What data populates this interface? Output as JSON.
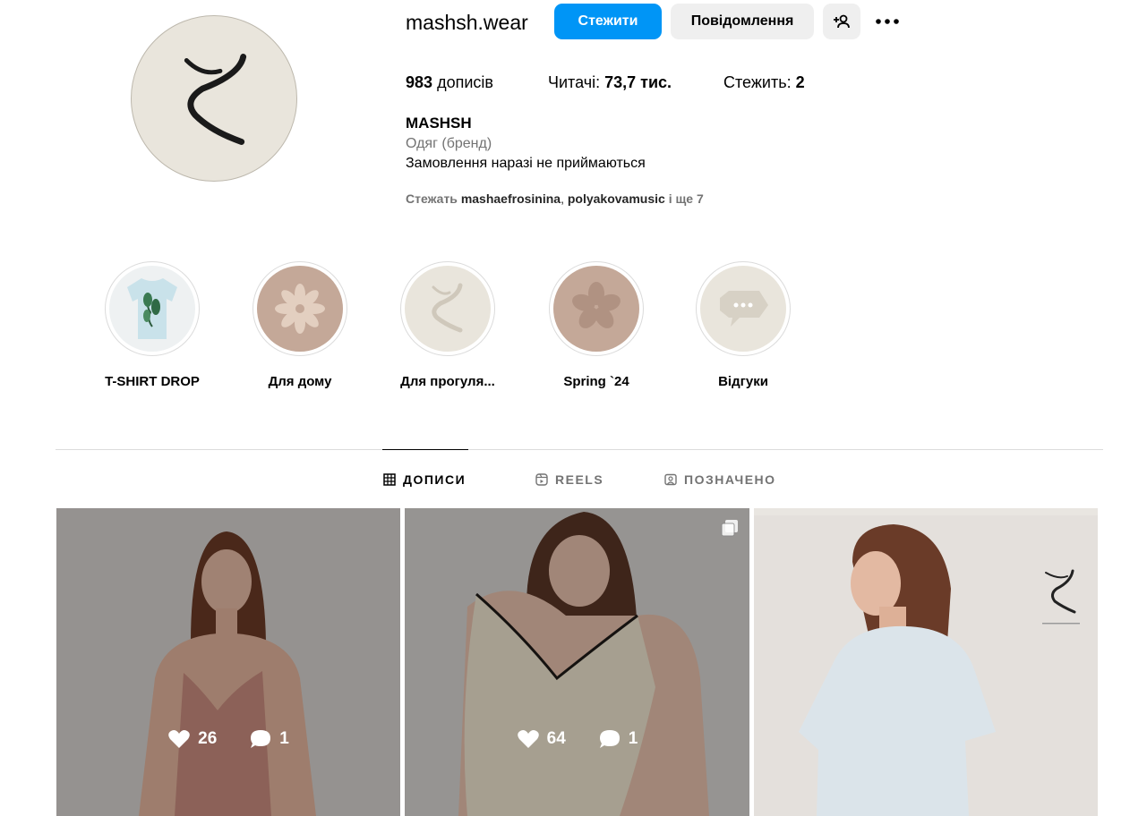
{
  "profile": {
    "username": "mashsh.wear",
    "follow_label": "Стежити",
    "message_label": "Повідомлення",
    "stats": {
      "posts_count": "983",
      "posts_label": "дописів",
      "followers_label": "Читачі:",
      "followers_count": "73,7 тис.",
      "following_label": "Стежить:",
      "following_count": "2"
    },
    "name": "MASHSH",
    "category": "Одяг (бренд)",
    "bio": "Замовлення наразі не приймаються",
    "followed_by": {
      "prefix": "Стежать",
      "account1": "mashaefrosinina",
      "separator": ",",
      "account2": "polyakovamusic",
      "suffix": "і ще 7"
    }
  },
  "highlights": [
    {
      "label": "T-SHIRT DROP",
      "icon": "t-shirt-image"
    },
    {
      "label": "Для дому",
      "icon": "flower-icon"
    },
    {
      "label": "Для прогуля...",
      "icon": "brand-logo"
    },
    {
      "label": "Spring `24",
      "icon": "flower-icon"
    },
    {
      "label": "Відгуки",
      "icon": "chat-bubble-icon"
    }
  ],
  "tabs": [
    {
      "label": "ДОПИСИ",
      "icon": "grid-icon",
      "active": true
    },
    {
      "label": "REELS",
      "icon": "reels-icon",
      "active": false
    },
    {
      "label": "ПОЗНАЧЕНО",
      "icon": "tagged-icon",
      "active": false
    }
  ],
  "posts": [
    {
      "likes": "26",
      "comments": "1",
      "hovered": true
    },
    {
      "likes": "64",
      "comments": "1",
      "hovered": true,
      "carousel": true
    },
    {
      "likes": "",
      "comments": "",
      "hovered": false
    }
  ],
  "colors": {
    "primary_button": "#0095f6",
    "secondary_button": "#efefef",
    "muted_text": "#737373",
    "avatar_bg": "#e9e5dc",
    "highlight_brown": "#c4a898"
  }
}
